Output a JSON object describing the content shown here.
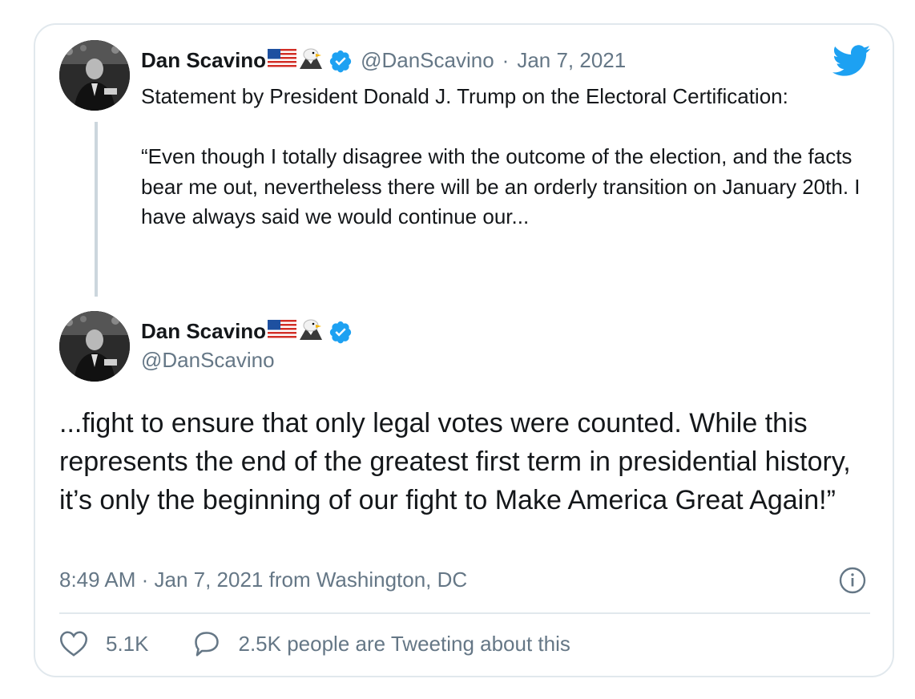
{
  "colors": {
    "accent": "#1da1f2",
    "text": "#14171a",
    "muted": "#657786",
    "border": "#e1e8ed",
    "thread_line": "#ccd6dd"
  },
  "icons": {
    "brand": "twitter-bird-icon",
    "verified": "verified-badge-icon",
    "flag": "us-flag-emoji",
    "eagle": "eagle-emoji",
    "info": "info-icon",
    "like": "heart-icon",
    "reply": "speech-bubble-icon"
  },
  "quoted_tweet": {
    "display_name": "Dan Scavino",
    "handle": "@DanScavino",
    "separator": "·",
    "date": "Jan 7, 2021",
    "text": "Statement by President Donald J. Trump on the Electoral Certification:\n\n“Even though I totally disagree with the outcome of the election, and the facts bear me out, nevertheless there will be an orderly transition on January 20th. I have always said we would continue our..."
  },
  "tweet": {
    "display_name": "Dan Scavino",
    "handle": "@DanScavino",
    "text": "...fight to ensure that only legal votes were counted. While this represents the end of the greatest first term in presidential history, it’s only the beginning of our fight to Make America Great Again!”",
    "timestamp": "8:49 AM · Jan 7, 2021 from Washington, DC",
    "likes": "5.1K",
    "conversation": "2.5K people are Tweeting about this"
  }
}
